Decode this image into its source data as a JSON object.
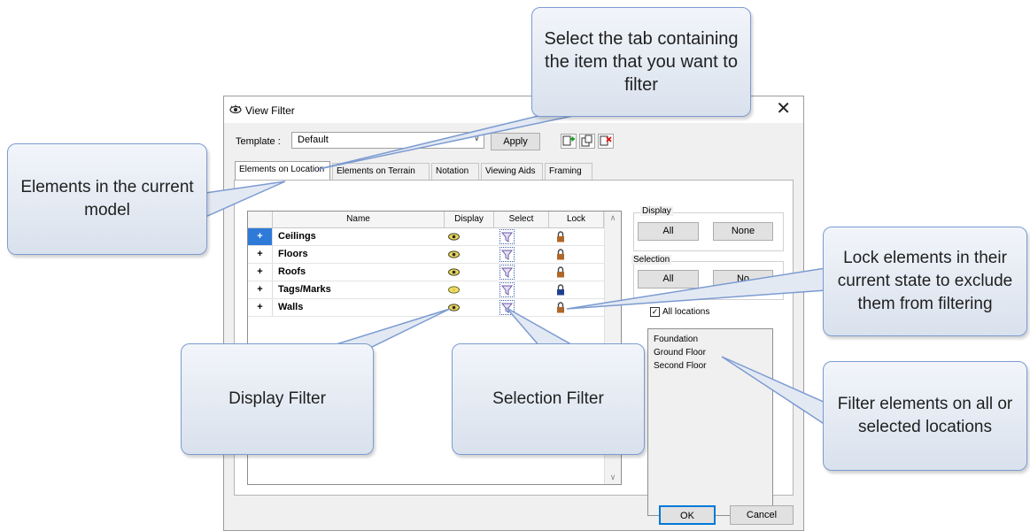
{
  "dialog": {
    "title": "View Filter",
    "close_glyph": "✕",
    "template_label": "Template :",
    "template_value": "Default",
    "apply_label": "Apply",
    "ok_label": "OK",
    "cancel_label": "Cancel",
    "tabs": [
      {
        "label": "Elements on Location",
        "active": true
      },
      {
        "label": "Elements on Terrain"
      },
      {
        "label": "Notation"
      },
      {
        "label": "Viewing Aids"
      },
      {
        "label": "Framing"
      }
    ],
    "grid": {
      "headers": {
        "name": "Name",
        "display": "Display",
        "select": "Select",
        "lock": "Lock"
      },
      "rows": [
        {
          "expander": "+",
          "name": "Ceilings",
          "lock_color": "#b0672a",
          "selected": true
        },
        {
          "expander": "+",
          "name": "Floors",
          "lock_color": "#b0672a"
        },
        {
          "expander": "+",
          "name": "Roofs",
          "lock_color": "#b0672a"
        },
        {
          "expander": "+",
          "name": "Tags/Marks",
          "lock_color": "#1f3f8f"
        },
        {
          "expander": "+",
          "name": "Walls",
          "lock_color": "#b0672a"
        }
      ]
    },
    "display_group": {
      "title": "Display",
      "all_label": "All",
      "none_label": "None"
    },
    "selection_group": {
      "title": "Selection",
      "all_label": "All",
      "none_label": "No"
    },
    "all_locations": {
      "label": "All locations",
      "checked": true
    },
    "locations": [
      "Foundation",
      "Ground Floor",
      "Second Floor"
    ]
  },
  "callouts": {
    "tab": "Select the tab containing the item that you want to filter",
    "elements": "Elements in the current model",
    "lock": "Lock elements in their current state to exclude them from filtering",
    "display": "Display Filter",
    "selection": "Selection Filter",
    "locations": "Filter elements on all or selected locations"
  },
  "colors": {
    "callout_border": "#7c9bd1",
    "selected_row": "#2e7ad8"
  }
}
